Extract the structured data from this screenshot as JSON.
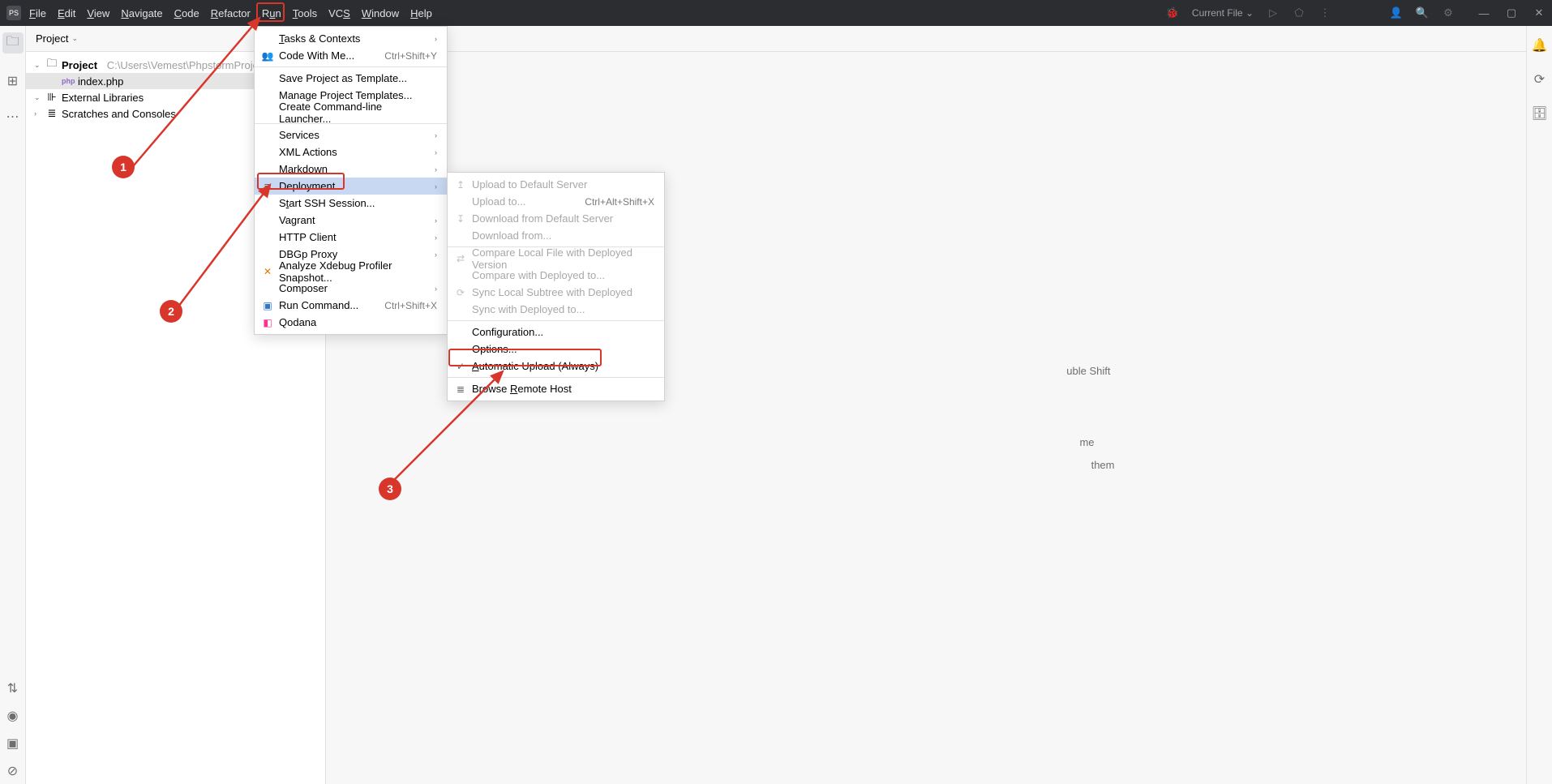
{
  "menubar": {
    "items": [
      "File",
      "Edit",
      "View",
      "Navigate",
      "Code",
      "Refactor",
      "Run",
      "Tools",
      "VCS",
      "Window",
      "Help"
    ],
    "current_file": "Current File"
  },
  "project_panel": {
    "title": "Project"
  },
  "tree": {
    "project_label": "Project",
    "project_path": "C:\\Users\\Vemest\\PhpstormProjects\\",
    "file1": "index.php",
    "ext_lib": "External Libraries",
    "scratches": "Scratches and Consoles"
  },
  "hints": {
    "l1": "uble Shift",
    "l2": "me",
    "l3": "them"
  },
  "tools_menu": {
    "tasks": "Tasks & Contexts",
    "codewithme": "Code With Me...",
    "codewithme_sc": "Ctrl+Shift+Y",
    "save_tpl": "Save Project as Template...",
    "manage_tpl": "Manage Project Templates...",
    "cmdline": "Create Command-line Launcher...",
    "services": "Services",
    "xml": "XML Actions",
    "markdown": "Markdown",
    "deployment": "Deployment",
    "ssh": "Start SSH Session...",
    "vagrant": "Vagrant",
    "http": "HTTP Client",
    "dbgp": "DBGp Proxy",
    "xdebug": "Analyze Xdebug Profiler Snapshot...",
    "composer": "Composer",
    "runcmd": "Run Command...",
    "runcmd_sc": "Ctrl+Shift+X",
    "qodana": "Qodana"
  },
  "deploy_menu": {
    "upload_def": "Upload to Default Server",
    "upload_to": "Upload to...",
    "upload_to_sc": "Ctrl+Alt+Shift+X",
    "download_def": "Download from Default Server",
    "download_from": "Download from...",
    "compare_local": "Compare Local File with Deployed Version",
    "compare_with": "Compare with Deployed to...",
    "sync_local": "Sync Local Subtree with Deployed",
    "sync_with": "Sync with Deployed to...",
    "config": "Configuration...",
    "options": "Options...",
    "auto_upload": "Automatic Upload (Always)",
    "browse": "Browse Remote Host"
  },
  "annotations": {
    "a1": "1",
    "a2": "2",
    "a3": "3"
  }
}
